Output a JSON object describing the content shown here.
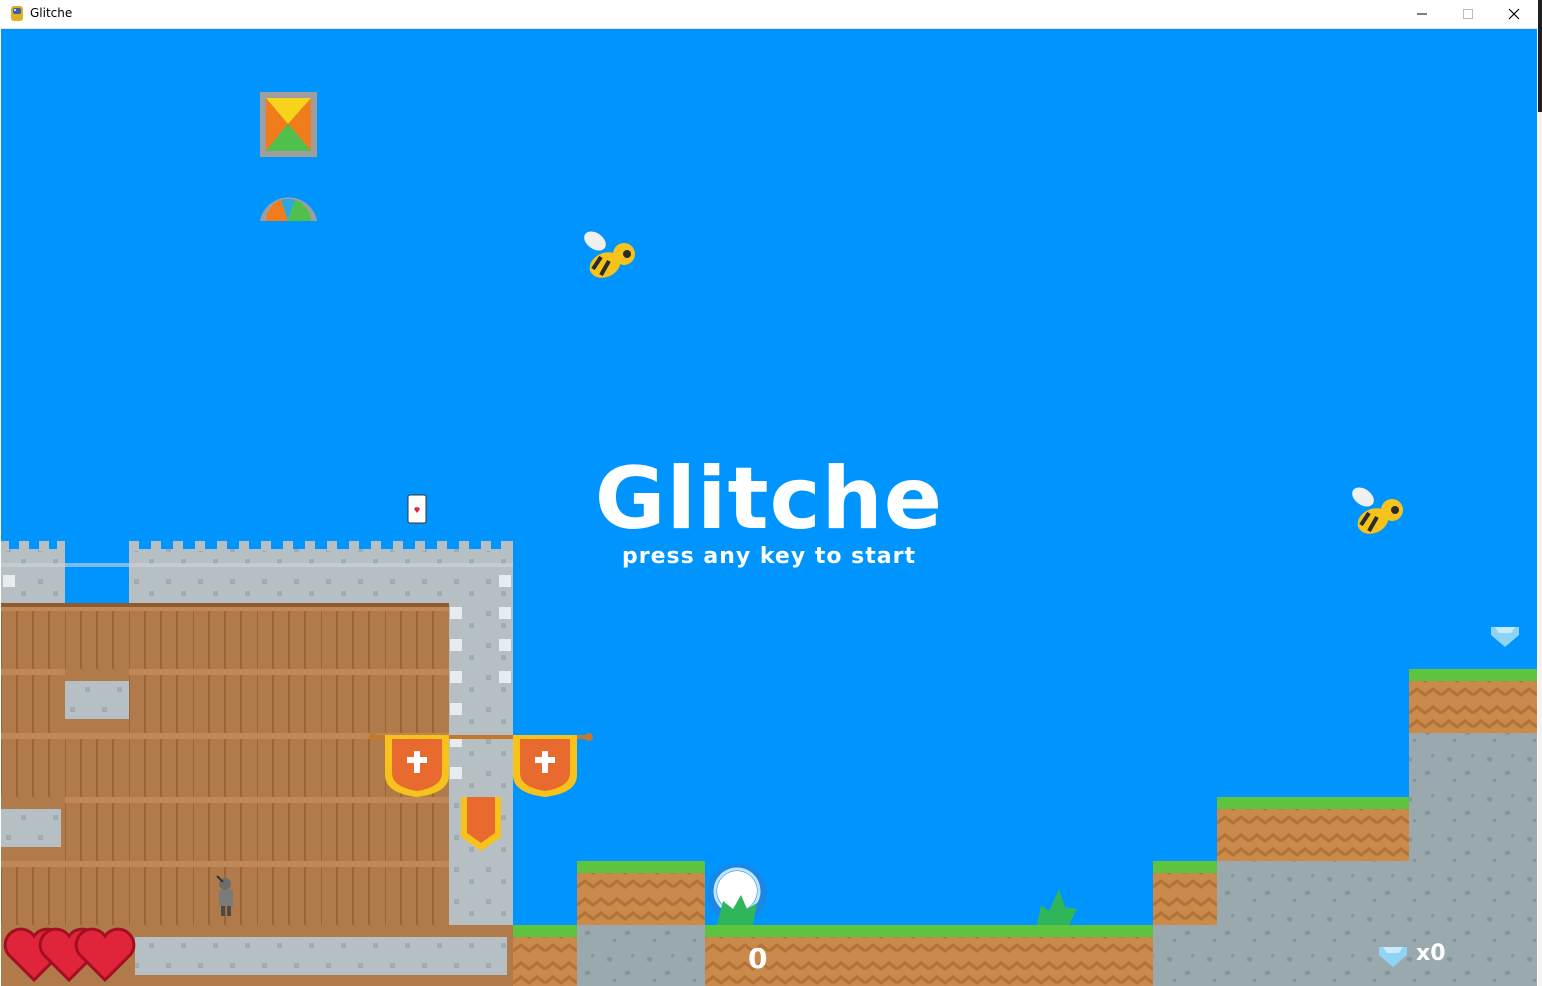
{
  "window": {
    "title": "Glitche",
    "controls": [
      "minimize-icon",
      "maximize-icon",
      "close-icon"
    ]
  },
  "game": {
    "title": "Glitche",
    "subtitle": "press any key to start",
    "score": "0",
    "gems": "x0",
    "hearts": 3,
    "colors": {
      "sky": "#0095fe",
      "grass": "#5ec43f",
      "dirt": "#c98a4c",
      "stone": "#a9b5bc",
      "wood": "#b57a47",
      "banner": "#f5a623"
    }
  }
}
